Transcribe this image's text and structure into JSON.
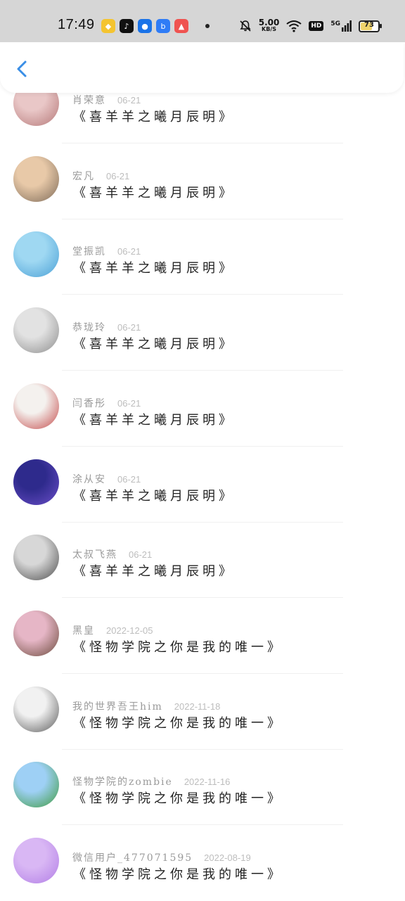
{
  "status_bar": {
    "time": "17:49",
    "speed_value": "5.00",
    "speed_unit": "KB/S",
    "hd": "HD",
    "network": "5G",
    "battery": "73",
    "battery_level": 0.73,
    "apps": [
      {
        "icon": "diamond-app-icon",
        "color": "#f4c430"
      },
      {
        "icon": "tiktok-app-icon",
        "color": "#111111"
      },
      {
        "icon": "circle-app-icon",
        "color": "#1a73e8"
      },
      {
        "icon": "bing-app-icon",
        "color": "#2f7cf6"
      },
      {
        "icon": "game-app-icon",
        "color": "#ef5350"
      }
    ]
  },
  "header": {
    "back_icon": "chevron-left-icon",
    "accent": "#3a8ee6"
  },
  "comments": [
    {
      "name": "肖荣意",
      "date": "06-21",
      "text": "《喜羊羊之曦月辰明》",
      "avatar_colors": [
        "#e9c7c7",
        "#b57878"
      ]
    },
    {
      "name": "宏凡",
      "date": "06-21",
      "text": "《喜羊羊之曦月辰明》",
      "avatar_colors": [
        "#e8c9a8",
        "#7d6a58"
      ]
    },
    {
      "name": "堂振凯",
      "date": "06-21",
      "text": "《喜羊羊之曦月辰明》",
      "avatar_colors": [
        "#9fd8f2",
        "#4aa0d6"
      ]
    },
    {
      "name": "恭珑玲",
      "date": "06-21",
      "text": "《喜羊羊之曦月辰明》",
      "avatar_colors": [
        "#e2e2e2",
        "#8d8d8d"
      ]
    },
    {
      "name": "闫香彤",
      "date": "06-21",
      "text": "《喜羊羊之曦月辰明》",
      "avatar_colors": [
        "#f4f1ee",
        "#c44a4a"
      ]
    },
    {
      "name": "涂从安",
      "date": "06-21",
      "text": "《喜羊羊之曦月辰明》",
      "avatar_colors": [
        "#2e2a8c",
        "#6b4ec8"
      ]
    },
    {
      "name": "太叔飞燕",
      "date": "06-21",
      "text": "《喜羊羊之曦月辰明》",
      "avatar_colors": [
        "#d7d7d7",
        "#4d4d4d"
      ]
    },
    {
      "name": "黑皇",
      "date": "2022-12-05",
      "text": "《怪物学院之你是我的唯一》",
      "avatar_colors": [
        "#e6b6c6",
        "#6b4a3b"
      ]
    },
    {
      "name": "我的世界吾王him",
      "date": "2022-11-18",
      "text": "《怪物学院之你是我的唯一》",
      "avatar_colors": [
        "#f1f1f1",
        "#5a5a5a"
      ]
    },
    {
      "name": "怪物学院的zombie",
      "date": "2022-11-16",
      "text": "《怪物学院之你是我的唯一》",
      "avatar_colors": [
        "#9ed0f5",
        "#3e9a3e"
      ]
    },
    {
      "name": "微信用户_477071595",
      "date": "2022-08-19",
      "text": "《怪物学院之你是我的唯一》",
      "avatar_colors": [
        "#d9b7f4",
        "#b27ee6"
      ]
    }
  ]
}
